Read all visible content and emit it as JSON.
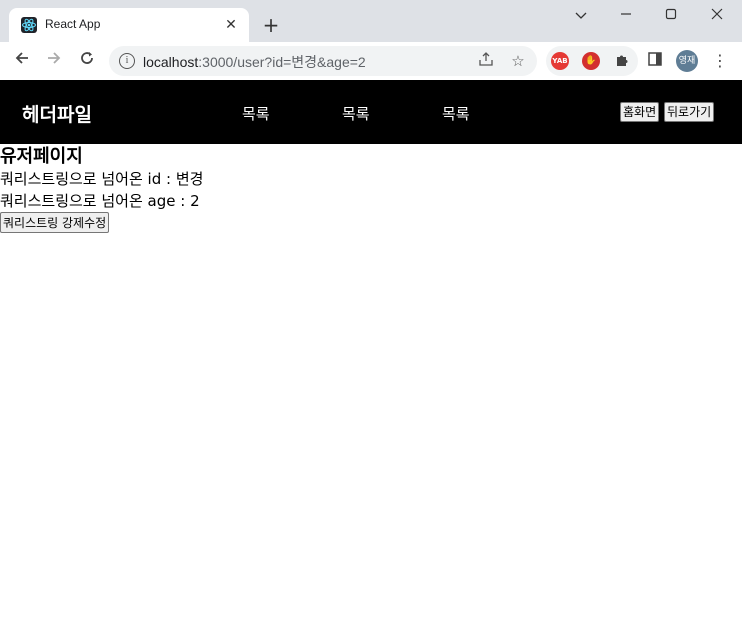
{
  "browser": {
    "tab_title": "React App",
    "tab_close_icon": "close-icon",
    "new_tab_icon": "plus-icon",
    "url_host": "localhost",
    "url_rest": ":3000/user?id=변경&age=2",
    "profile_initials": "영재",
    "extensions": [
      {
        "name": "yab-extension-icon",
        "label": "YAB",
        "color": "#e53935"
      },
      {
        "name": "hand-extension-icon",
        "label": "✋",
        "color": "#d32f2f"
      }
    ]
  },
  "header": {
    "brand": "헤더파일",
    "nav": [
      "목록",
      "목록",
      "목록"
    ],
    "home_button": "홈화면",
    "back_button": "뒤로가기"
  },
  "main": {
    "title": "유저페이지",
    "id_line": "쿼리스트링으로 넘어온 id : 변경",
    "age_line": "쿼리스트링으로 넘어온 age : 2",
    "force_button": "쿼리스트링 강제수정"
  }
}
